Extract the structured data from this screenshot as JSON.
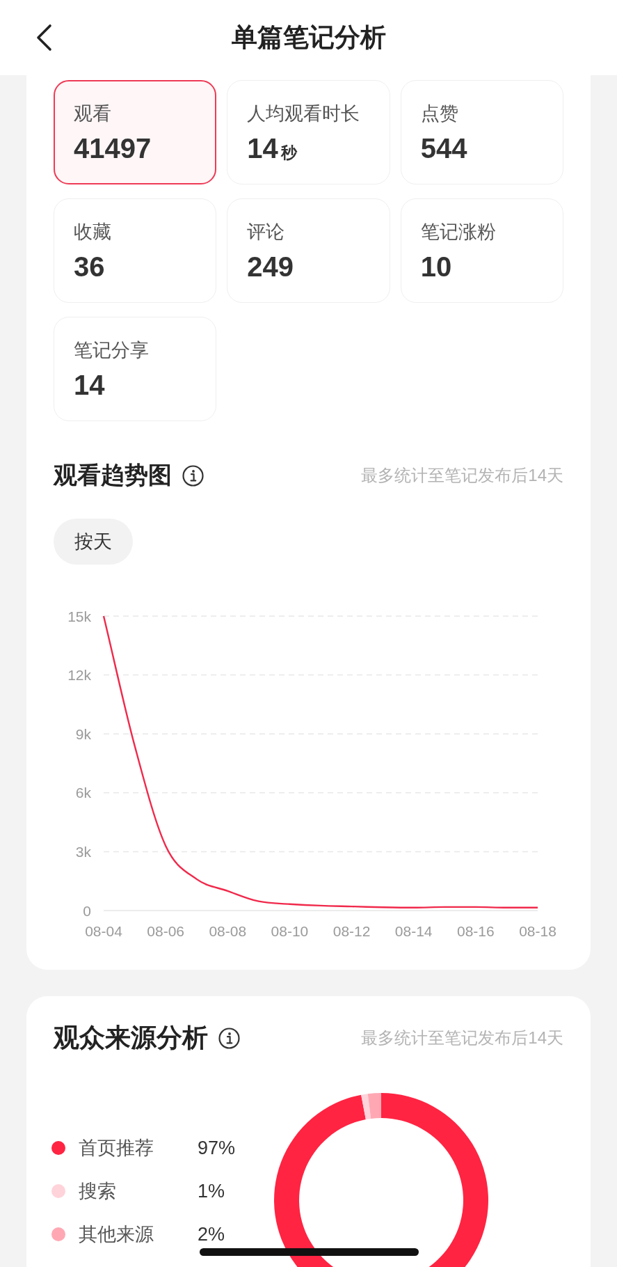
{
  "header": {
    "title": "单篇笔记分析"
  },
  "stats": [
    {
      "label": "观看",
      "value": "41497",
      "selected": true
    },
    {
      "label": "人均观看时长",
      "value": "14",
      "unit": "秒",
      "selected": false
    },
    {
      "label": "点赞",
      "value": "544",
      "selected": false
    },
    {
      "label": "收藏",
      "value": "36",
      "selected": false
    },
    {
      "label": "评论",
      "value": "249",
      "selected": false
    },
    {
      "label": "笔记涨粉",
      "value": "10",
      "selected": false
    },
    {
      "label": "笔记分享",
      "value": "14",
      "selected": false
    }
  ],
  "view_trend": {
    "title": "观看趋势图",
    "note": "最多统计至笔记发布后14天",
    "filters": [
      {
        "label": "按天",
        "selected": true
      }
    ],
    "chart_data": {
      "type": "line",
      "grid": true,
      "categories": [
        "08-04",
        null,
        "08-06",
        null,
        "08-08",
        null,
        "08-10",
        null,
        "08-12",
        null,
        "08-14",
        null,
        "08-16",
        null,
        "08-18"
      ],
      "ylim": [
        0,
        15000
      ],
      "yticks": [
        {
          "value": 0,
          "label": "0"
        },
        {
          "value": 3000,
          "label": "3k"
        },
        {
          "value": 6000,
          "label": "6k"
        },
        {
          "value": 9000,
          "label": "9k"
        },
        {
          "value": 12000,
          "label": "12k"
        },
        {
          "value": 15000,
          "label": "15k"
        }
      ],
      "series": [
        {
          "color": "#f0294b",
          "values": [
            15000,
            8400,
            3300,
            1600,
            1000,
            470,
            330,
            250,
            210,
            170,
            150,
            180,
            180,
            150,
            150
          ]
        }
      ]
    }
  },
  "audience_sources": {
    "title": "观众来源分析",
    "note": "最多统计至笔记发布后14天",
    "items": [
      {
        "name": "首页推荐",
        "share": "97%",
        "color": "#ff2442"
      },
      {
        "name": "搜索",
        "share": "1%",
        "color": "#ffd3da"
      },
      {
        "name": "其他来源",
        "share": "2%",
        "color": "#ffa8b4"
      }
    ],
    "chart_data": {
      "type": "donut",
      "values": [
        97,
        1,
        2
      ]
    }
  }
}
